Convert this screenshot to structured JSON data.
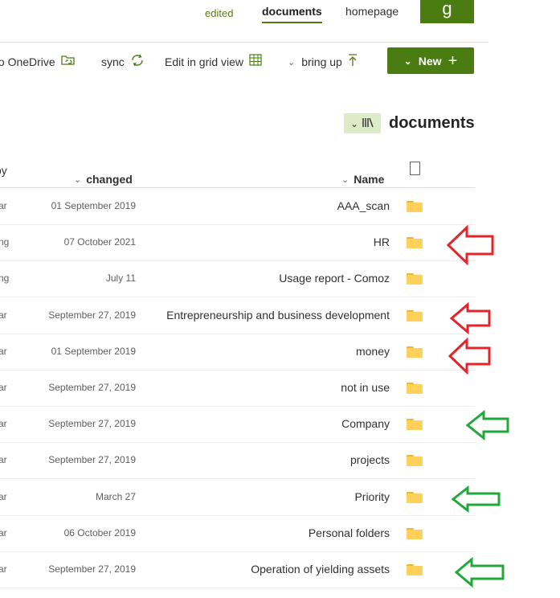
{
  "nav": {
    "edited": "edited",
    "documents": "documents",
    "homepage": "homepage",
    "tab_glyph": "g"
  },
  "commands": {
    "onedrive": "to OneDrive",
    "sync": "sync",
    "grid": "Edit in grid view",
    "bring_up": "bring up",
    "new": "New"
  },
  "library": {
    "title": "documents"
  },
  "columns": {
    "by": "oy",
    "changed": "changed",
    "name": "Name"
  },
  "rows": [
    {
      "by": "ar",
      "date": "01 September 2019",
      "name": "AAA_scan"
    },
    {
      "by": "ng",
      "date": "07 October 2021",
      "name": "HR"
    },
    {
      "by": "ng",
      "date": "July 11",
      "name": "Usage report - Comoz"
    },
    {
      "by": "ar",
      "date": "September 27, 2019",
      "name": "Entrepreneurship and business development"
    },
    {
      "by": "ar",
      "date": "01 September 2019",
      "name": "money"
    },
    {
      "by": "ar",
      "date": "September 27, 2019",
      "name": "not in use"
    },
    {
      "by": "ar",
      "date": "September 27, 2019",
      "name": "Company"
    },
    {
      "by": "ar",
      "date": "September 27, 2019",
      "name": "projects"
    },
    {
      "by": "ar",
      "date": "March 27",
      "name": "Priority"
    },
    {
      "by": "ar",
      "date": "06 October 2019",
      "name": "Personal folders"
    },
    {
      "by": "ar",
      "date": "September 27, 2019",
      "name": "Operation of yielding assets"
    }
  ],
  "colors": {
    "accent": "#4a7c12",
    "red_arrow": "#e3242b",
    "green_arrow": "#22a83a",
    "folder": "#ffd15a"
  }
}
